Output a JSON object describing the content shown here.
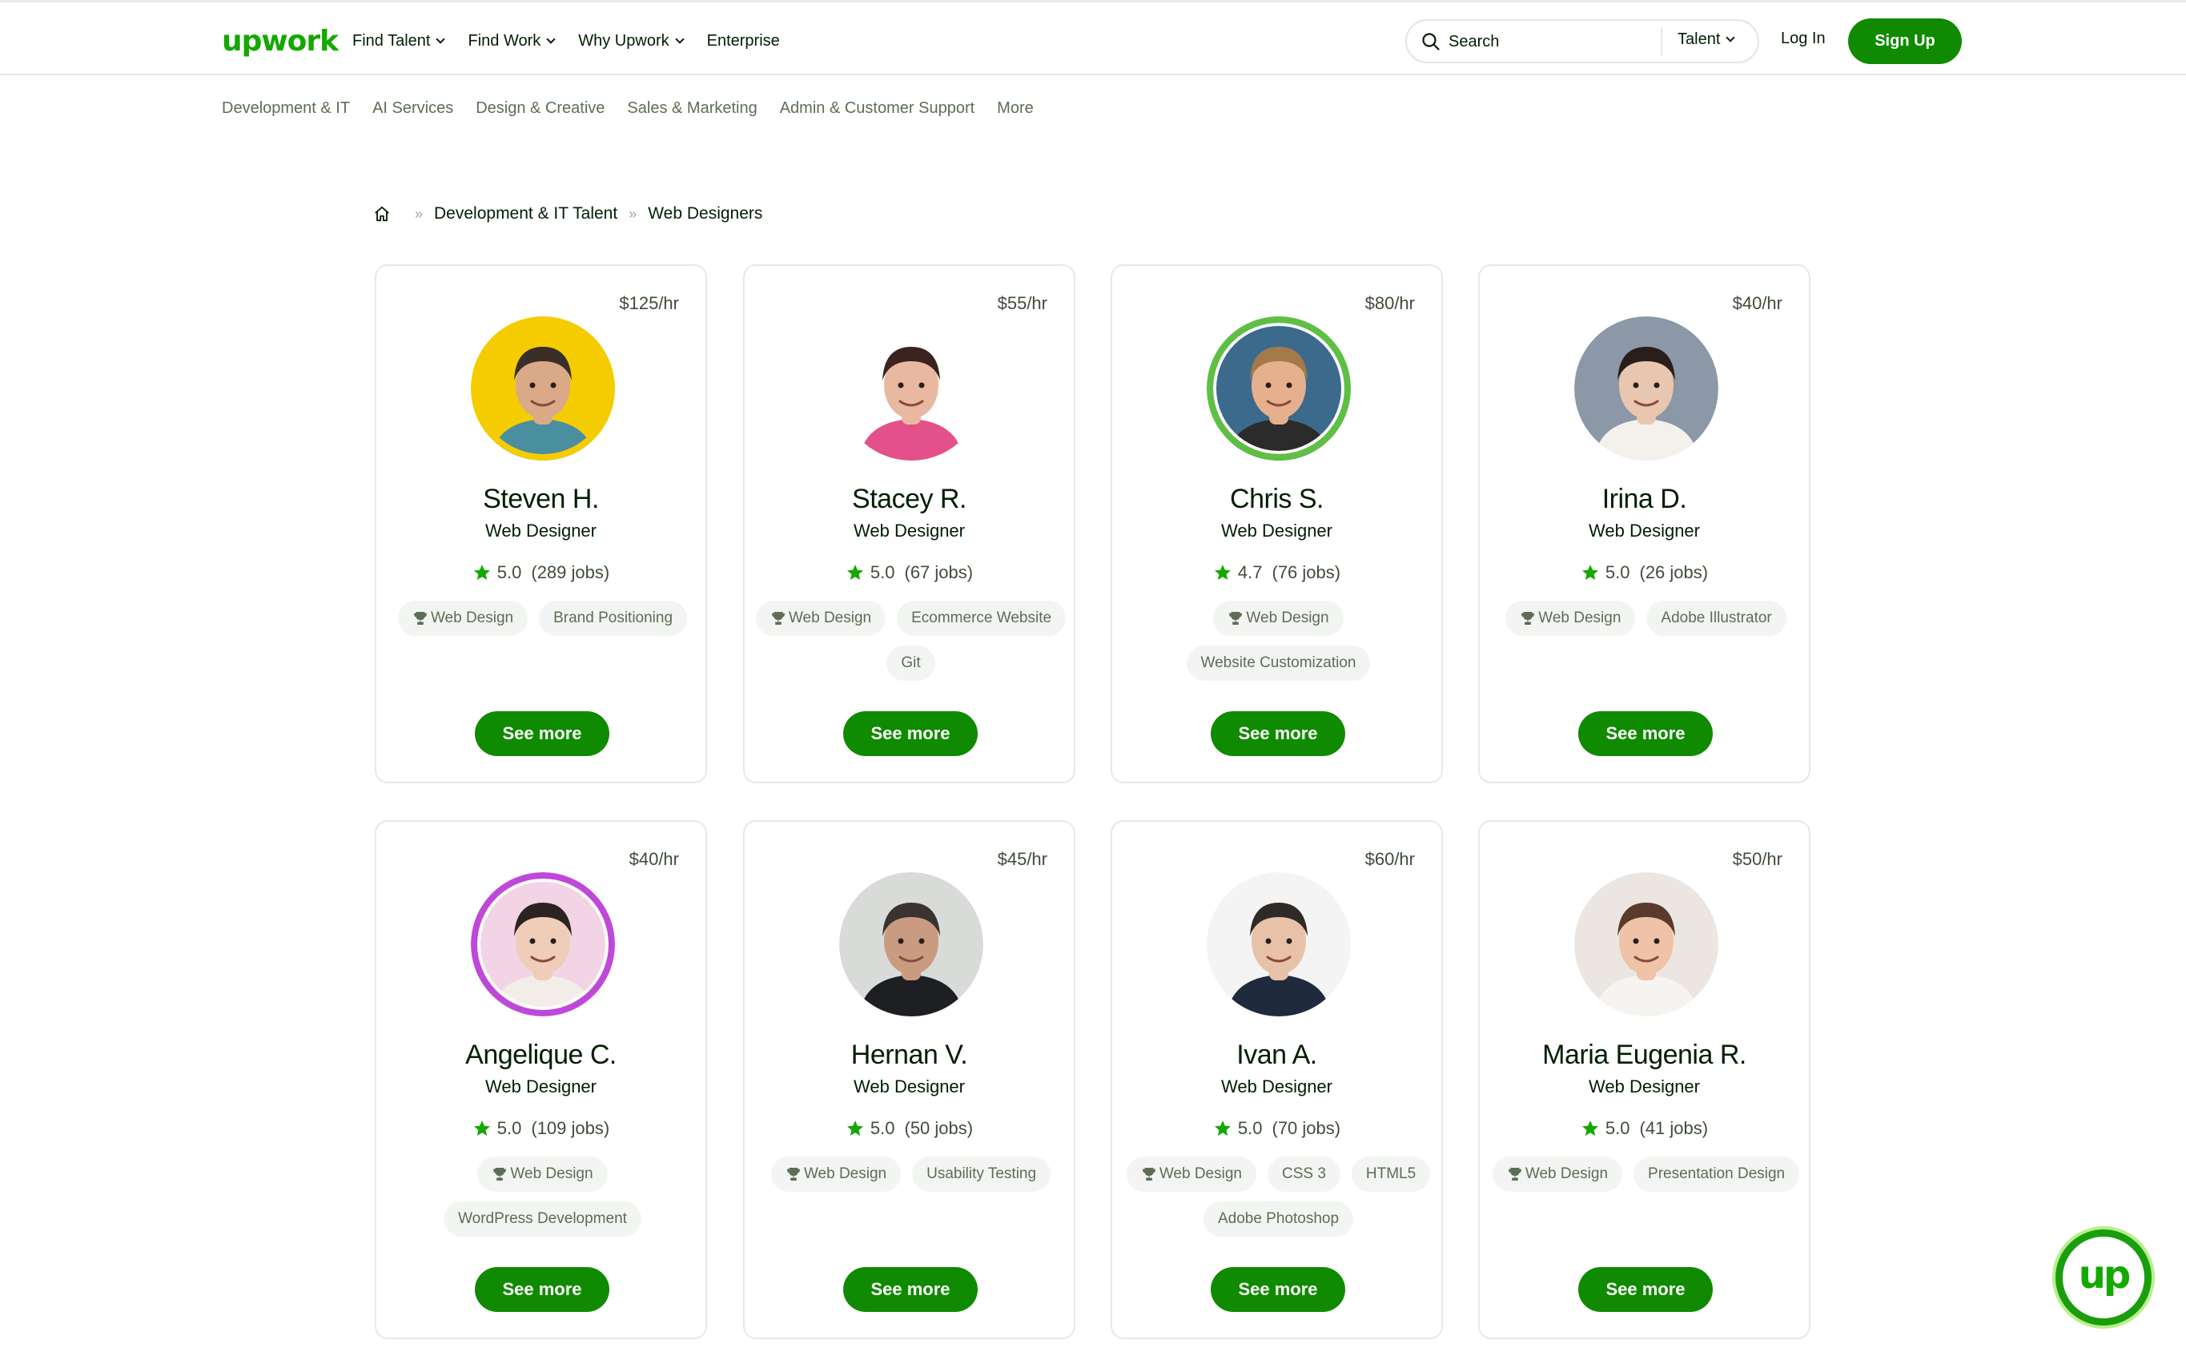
{
  "brand": {
    "logo_text": "upwork",
    "accent": "#14a800",
    "button": "#108a00"
  },
  "header": {
    "nav": [
      {
        "label": "Find Talent",
        "dropdown": true
      },
      {
        "label": "Find Work",
        "dropdown": true
      },
      {
        "label": "Why Upwork",
        "dropdown": true
      },
      {
        "label": "Enterprise",
        "dropdown": false
      }
    ],
    "search": {
      "placeholder": "Search",
      "scope": "Talent"
    },
    "login_label": "Log In",
    "signup_label": "Sign Up"
  },
  "categories": [
    "Development & IT",
    "AI Services",
    "Design & Creative",
    "Sales & Marketing",
    "Admin & Customer Support",
    "More"
  ],
  "breadcrumb": {
    "link": "Development & IT Talent",
    "current": "Web Designers",
    "separator": "»"
  },
  "see_more_label": "See more",
  "freelancers": [
    {
      "rate": "$125/hr",
      "name": "Steven H.",
      "title": "Web Designer",
      "score": "5.0",
      "jobs": "(289 jobs)",
      "skills": [
        "Web Design",
        "Brand Positioning"
      ],
      "ring": "#f5cc00",
      "skin": "#d9a988",
      "hair": "#3a2e28",
      "shirt": "#4a8fa0",
      "bg": "#f5cc00"
    },
    {
      "rate": "$55/hr",
      "name": "Stacey R.",
      "title": "Web Designer",
      "score": "5.0",
      "jobs": "(67 jobs)",
      "skills": [
        "Web Design",
        "Ecommerce Website",
        "Git"
      ],
      "ring": "none",
      "skin": "#e8b9a0",
      "hair": "#3b2320",
      "shirt": "#e4508a",
      "bg": "#ffffff"
    },
    {
      "rate": "$80/hr",
      "name": "Chris S.",
      "title": "Web Designer",
      "score": "4.7",
      "jobs": "(76 jobs)",
      "skills": [
        "Web Design",
        "Website Customization"
      ],
      "ring": "#5ec042",
      "skin": "#e6b08e",
      "hair": "#a57a4a",
      "shirt": "#2b2b2b",
      "bg": "#3c6a8c"
    },
    {
      "rate": "$40/hr",
      "name": "Irina D.",
      "title": "Web Designer",
      "score": "5.0",
      "jobs": "(26 jobs)",
      "skills": [
        "Web Design",
        "Adobe Illustrator"
      ],
      "ring": "none",
      "skin": "#e9c6b0",
      "hair": "#2a1e1a",
      "shirt": "#f4f1ec",
      "bg": "#8c98a8"
    },
    {
      "rate": "$40/hr",
      "name": "Angelique C.",
      "title": "Web Designer",
      "score": "5.0",
      "jobs": "(109 jobs)",
      "skills": [
        "Web Design",
        "WordPress Development"
      ],
      "ring": "#c048d8",
      "skin": "#efcdb8",
      "hair": "#2b2322",
      "shirt": "#f2ede8",
      "bg": "#f3d4e4"
    },
    {
      "rate": "$45/hr",
      "name": "Hernan V.",
      "title": "Web Designer",
      "score": "5.0",
      "jobs": "(50 jobs)",
      "skills": [
        "Web Design",
        "Usability Testing"
      ],
      "ring": "none",
      "skin": "#c99c82",
      "hair": "#3a3330",
      "shirt": "#1d1f22",
      "bg": "#d9dbd8"
    },
    {
      "rate": "$60/hr",
      "name": "Ivan A.",
      "title": "Web Designer",
      "score": "5.0",
      "jobs": "(70 jobs)",
      "skills": [
        "Web Design",
        "CSS 3",
        "HTML5",
        "Adobe Photoshop"
      ],
      "ring": "none",
      "skin": "#e8c2a8",
      "hair": "#2e2a28",
      "shirt": "#1f2a3c",
      "bg": "#f4f4f4"
    },
    {
      "rate": "$50/hr",
      "name": "Maria Eugenia R.",
      "title": "Web Designer",
      "score": "5.0",
      "jobs": "(41 jobs)",
      "skills": [
        "Web Design",
        "Presentation Design"
      ],
      "ring": "none",
      "skin": "#eec3a8",
      "hair": "#5a3a2a",
      "shirt": "#f6f4f0",
      "bg": "#ebe6e2"
    }
  ]
}
